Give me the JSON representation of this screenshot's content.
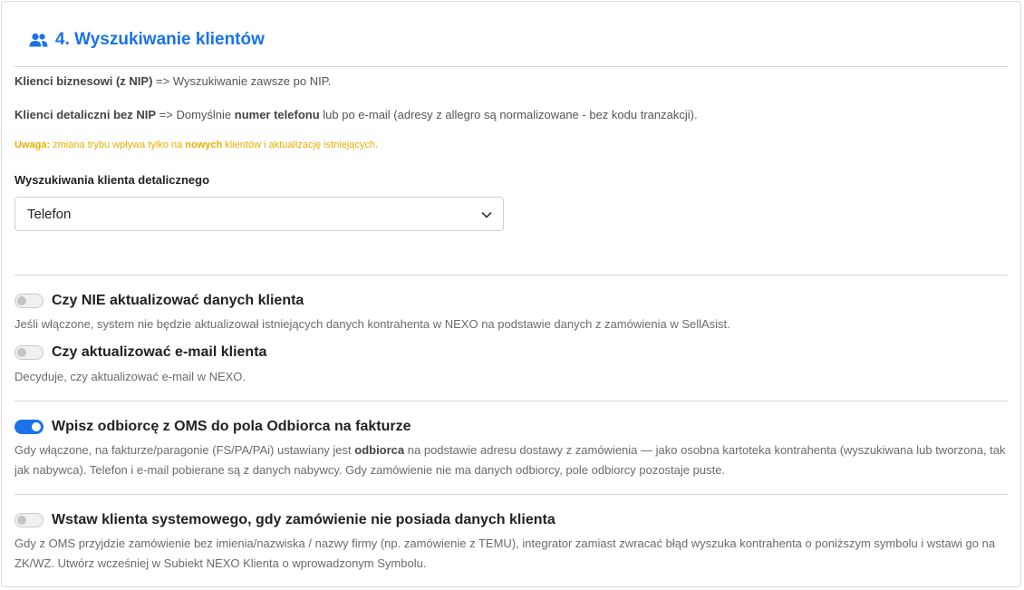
{
  "section": {
    "title": "4. Wyszukiwanie klientów",
    "icon": "users-icon",
    "accent_color": "#1a73e8"
  },
  "info": {
    "business_label": "Klienci biznesowi (z NIP)",
    "business_text": " => Wyszukiwanie zawsze po NIP.",
    "retail_label": "Klienci detaliczni bez NIP",
    "retail_text_1": " => Domyślnie ",
    "retail_bold": "numer telefonu",
    "retail_text_2": " lub po e-mail (adresy z allegro są normalizowane - bez kodu tranzakcji)."
  },
  "warning": {
    "label": "Uwaga:",
    "text_1": " zmiana trybu wpływa tylko na ",
    "bold": "nowych",
    "text_2": " klientów i aktualizację istniejących.",
    "color": "#e5b000"
  },
  "search_field": {
    "label": "Wyszukiwania klienta detalicznego",
    "value": "Telefon"
  },
  "options": [
    {
      "title": "Czy NIE aktualizować danych klienta",
      "enabled": false,
      "desc": "Jeśli włączone, system nie będzie aktualizował istniejących danych kontrahenta w NEXO na podstawie danych z zamówienia w SellAsist."
    },
    {
      "title": "Czy aktualizować e-mail klienta",
      "enabled": false,
      "desc": "Decyduje, czy aktualizować e-mail w NEXO."
    },
    {
      "title": "Wpisz odbiorcę z OMS do pola Odbiorca na fakturze",
      "enabled": true,
      "desc_1": "Gdy włączone, na fakturze/paragonie (FS/PA/PAi) ustawiany jest ",
      "desc_bold": "odbiorca",
      "desc_2": " na podstawie adresu dostawy z zamówienia — jako osobna kartoteka kontrahenta (wyszukiwana lub tworzona, tak jak nabywca). Telefon i e-mail pobierane są z danych nabywcy. Gdy zamówienie nie ma danych odbiorcy, pole odbiorcy pozostaje puste."
    },
    {
      "title": "Wstaw klienta systemowego, gdy zamówienie nie posiada danych klienta",
      "enabled": false,
      "desc": "Gdy z OMS przyjdzie zamówienie bez imienia/nazwiska / nazwy firmy (np. zamówienie z TEMU), integrator zamiast zwracać błąd wyszuka kontrahenta o poniższym symbolu i wstawi go na ZK/WZ. Utwórz wcześniej w Subiekt NEXO Klienta o wprowadzonym Symbolu."
    }
  ]
}
